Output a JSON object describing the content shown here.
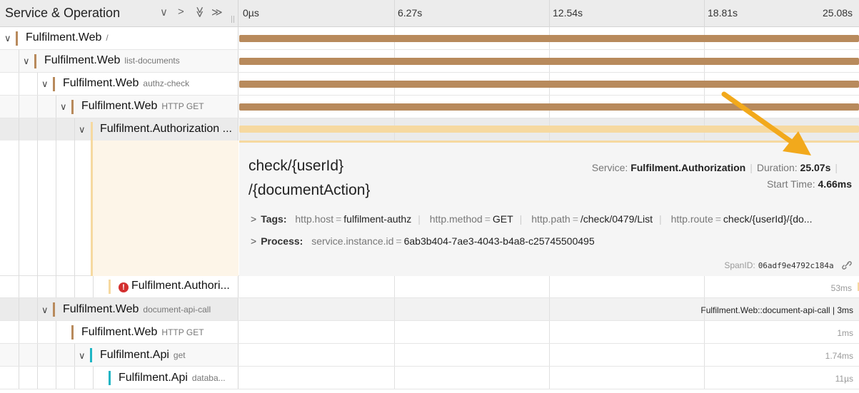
{
  "header": {
    "title": "Service & Operation",
    "ticks": [
      "0µs",
      "6.27s",
      "12.54s",
      "18.81s",
      "25.08s"
    ],
    "controls": [
      "∨",
      ">",
      "≫",
      "≫"
    ]
  },
  "rows": [
    {
      "service": "Fulfilment.Web",
      "operation": "/"
    },
    {
      "service": "Fulfilment.Web",
      "operation": "list-documents"
    },
    {
      "service": "Fulfilment.Web",
      "operation": "authz-check"
    },
    {
      "service": "Fulfilment.Web",
      "operation": "HTTP GET"
    },
    {
      "service": "Fulfilment.Authorization ...",
      "operation": ""
    },
    {
      "service": "Fulfilment.Authori...",
      "operation": "",
      "duration": "53ms"
    },
    {
      "service": "Fulfilment.Web",
      "operation": "document-api-call",
      "duration": "Fulfilment.Web::document-api-call | 3ms"
    },
    {
      "service": "Fulfilment.Web",
      "operation": "HTTP GET",
      "duration": "1ms"
    },
    {
      "service": "Fulfilment.Api",
      "operation": "get",
      "duration": "1.74ms"
    },
    {
      "service": "Fulfilment.Api",
      "operation": "databa...",
      "duration": "11µs"
    }
  ],
  "detail": {
    "operation_line1": "check/{userId}",
    "operation_line2": "/{documentAction}",
    "service_label": "Service:",
    "service_value": "Fulfilment.Authorization",
    "duration_label": "Duration:",
    "duration_value": "25.07s",
    "start_label": "Start Time:",
    "start_value": "4.66ms",
    "tags_label": "Tags:",
    "tags": [
      {
        "key": "http.host",
        "value": "fulfilment-authz"
      },
      {
        "key": "http.method",
        "value": "GET"
      },
      {
        "key": "http.path",
        "value": "/check/0479/List"
      },
      {
        "key": "http.route",
        "value": "check/{userId}/{do..."
      }
    ],
    "process_label": "Process:",
    "process": [
      {
        "key": "service.instance.id",
        "value": "6ab3b404-7ae3-4043-b4a8-c25745500495"
      }
    ],
    "spanid_label": "SpanID:",
    "spanid_value": "06adf9e4792c184a"
  },
  "colors": {
    "web": "#b88a5c",
    "authz": "#f6d9a0",
    "api": "#1fb5c4",
    "arrow": "#f2a91c",
    "error": "#d32f2f"
  },
  "icons": [
    "chevron-down-icon",
    "chevron-right-icon",
    "error-icon",
    "link-icon",
    "arrow-annotation"
  ]
}
